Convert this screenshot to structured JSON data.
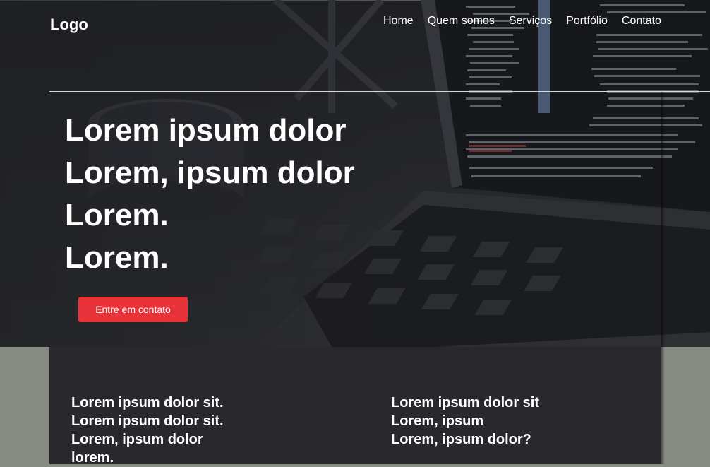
{
  "header": {
    "logo": "Logo",
    "nav": [
      "Home",
      "Quem somos",
      "Serviços",
      "Portfólio",
      "Contato"
    ]
  },
  "hero": {
    "lines": [
      "Lorem ipsum dolor",
      "Lorem, ipsum dolor",
      "Lorem.",
      "Lorem."
    ],
    "cta_label": "Entre em contato"
  },
  "features": {
    "left": [
      "Lorem ipsum dolor sit.",
      "Lorem ipsum dolor sit.",
      "Lorem, ipsum dolor",
      "lorem."
    ],
    "right": [
      "Lorem ipsum dolor sit",
      "Lorem, ipsum",
      "Lorem, ipsum dolor?"
    ]
  },
  "colors": {
    "accent": "#e8333b",
    "hero_bg": "#26272b",
    "page_bg": "#878c82",
    "panel_bg": "#28282d"
  }
}
